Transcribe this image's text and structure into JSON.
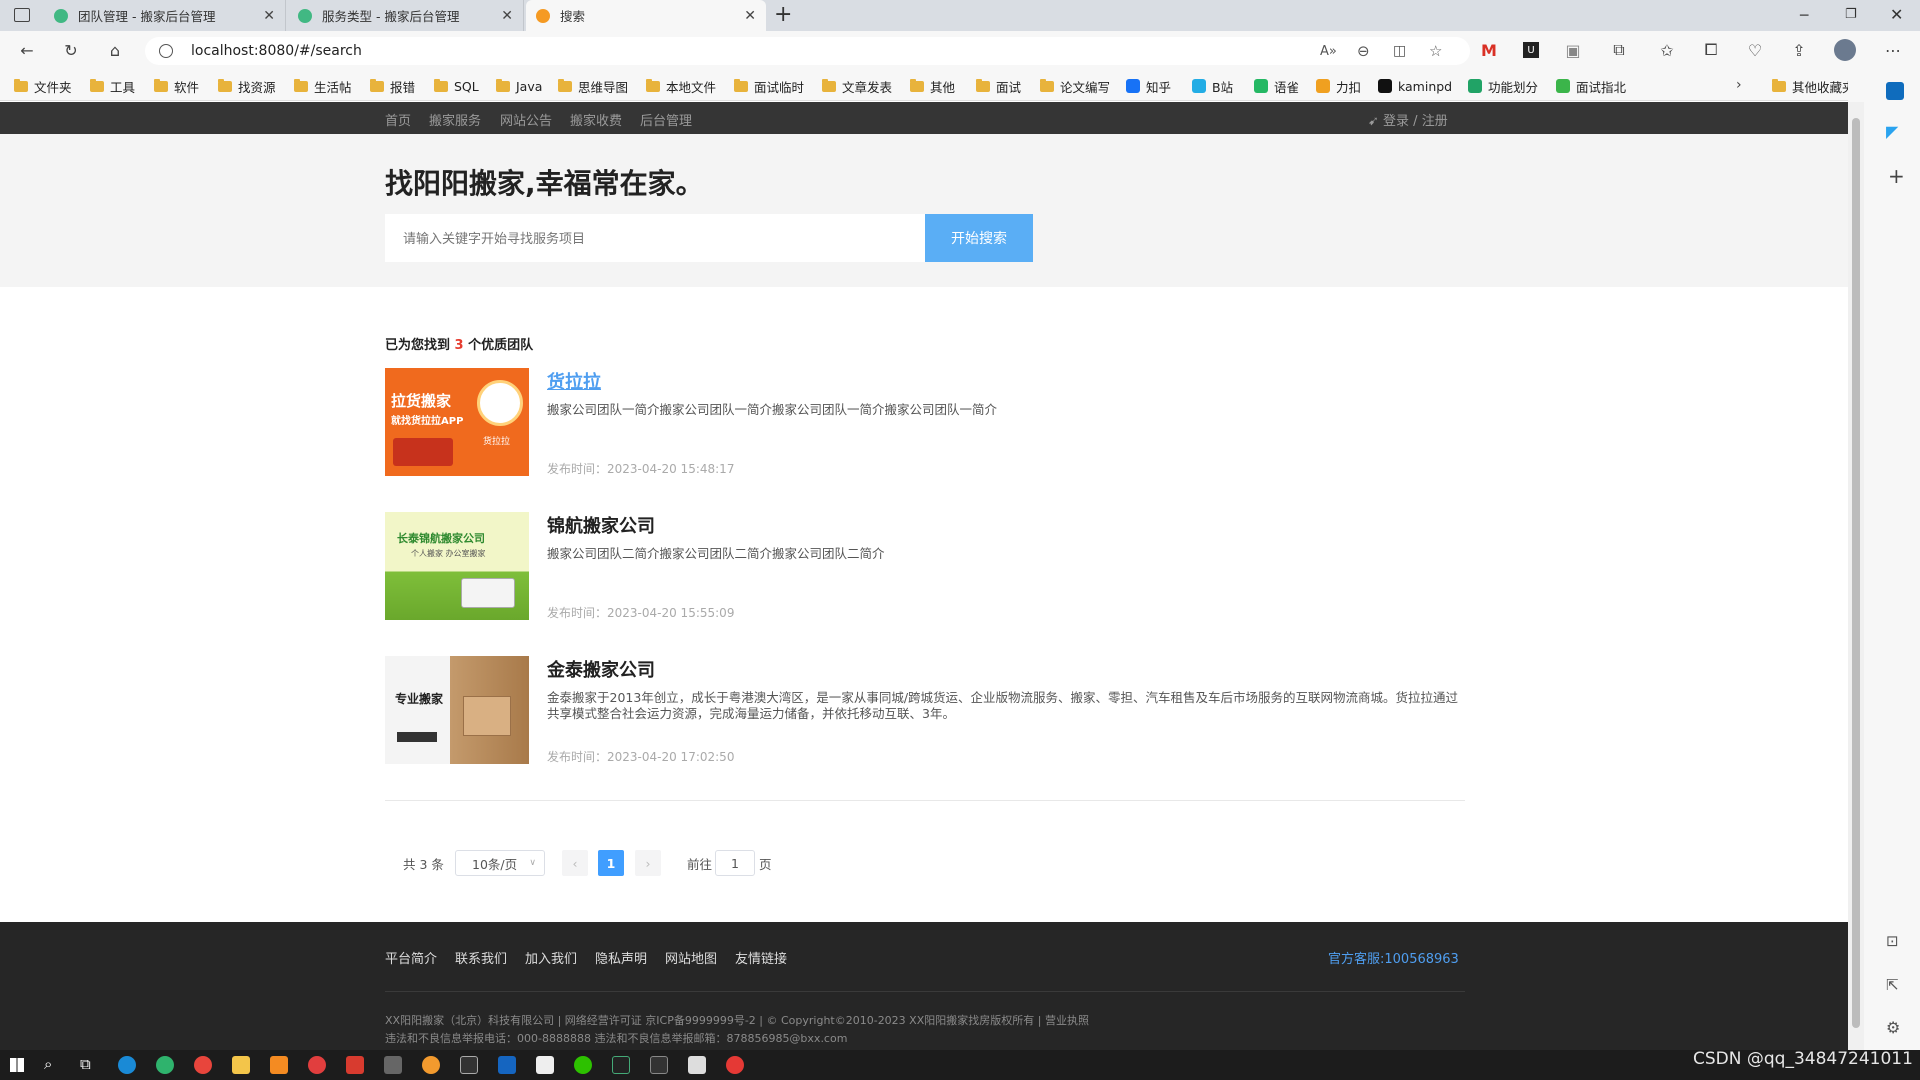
{
  "browser": {
    "tabs": [
      {
        "title": "团队管理 - 搬家后台管理",
        "favicon_color": "#41b883"
      },
      {
        "title": "服务类型 - 搬家后台管理",
        "favicon_color": "#41b883"
      },
      {
        "title": "搜索",
        "favicon_color": "#f59a23"
      }
    ],
    "new_tab": "+",
    "url": "localhost:8080/#/search",
    "window_controls": [
      "minimize-icon",
      "restore-icon",
      "close-icon"
    ],
    "bookmarks": [
      {
        "label": "文件夹",
        "type": "folder"
      },
      {
        "label": "工具",
        "type": "folder"
      },
      {
        "label": "软件",
        "type": "folder"
      },
      {
        "label": "找资源",
        "type": "folder"
      },
      {
        "label": "生活帖",
        "type": "folder"
      },
      {
        "label": "报错",
        "type": "folder"
      },
      {
        "label": "SQL",
        "type": "folder"
      },
      {
        "label": "Java",
        "type": "folder"
      },
      {
        "label": "思维导图",
        "type": "folder"
      },
      {
        "label": "本地文件",
        "type": "folder"
      },
      {
        "label": "面试临时",
        "type": "folder"
      },
      {
        "label": "文章发表",
        "type": "folder"
      },
      {
        "label": "其他",
        "type": "folder"
      },
      {
        "label": "面试",
        "type": "folder"
      },
      {
        "label": "论文编写",
        "type": "folder"
      },
      {
        "label": "知乎",
        "type": "site",
        "color": "#1772f6"
      },
      {
        "label": "B站",
        "type": "site",
        "color": "#23ade5"
      },
      {
        "label": "语雀",
        "type": "site",
        "color": "#25b864"
      },
      {
        "label": "力扣",
        "type": "site",
        "color": "#f0a020"
      },
      {
        "label": "kaminpd",
        "type": "site",
        "color": "#111111"
      },
      {
        "label": "功能划分",
        "type": "site",
        "color": "#21a366"
      },
      {
        "label": "面试指北",
        "type": "site",
        "color": "#3bb54a"
      }
    ],
    "other_bookmarks": "其他收藏夹"
  },
  "site": {
    "nav": [
      "首页",
      "搬家服务",
      "网站公告",
      "搬家收费",
      "后台管理"
    ],
    "login": "登录 / 注册",
    "slogan": "找阳阳搬家,幸福常在家。",
    "search_placeholder": "请输入关键字开始寻找服务项目",
    "search_button": "开始搜索",
    "found_prefix": "已为您找到",
    "found_count": "3",
    "found_suffix": "个优质团队",
    "results": [
      {
        "name": "货拉拉",
        "desc": "搬家公司团队一简介搬家公司团队一简介搬家公司团队一简介搬家公司团队一简介",
        "time": "发布时间：2023-04-20 15:48:17",
        "thumb_text": [
          "拉货搬家",
          "就找货拉拉APP",
          "货拉拉"
        ]
      },
      {
        "name": "锦航搬家公司",
        "desc": "搬家公司团队二简介搬家公司团队二简介搬家公司团队二简介",
        "time": "发布时间：2023-04-20 15:55:09",
        "thumb_text": [
          "长泰锦航搬家公司",
          "个人搬家 办公室搬家"
        ]
      },
      {
        "name": "金泰搬家公司",
        "desc": "金泰搬家于2013年创立，成长于粤港澳大湾区，是一家从事同城/跨城货运、企业版物流服务、搬家、零担、汽车租售及车后市场服务的互联网物流商城。货拉拉通过共享模式整合社会运力资源，完成海量运力储备，并依托移动互联、3年。",
        "time": "发布时间：2023-04-20 17:02:50",
        "thumb_text": [
          "专业搬家"
        ]
      }
    ],
    "pagination": {
      "total": "共 3 条",
      "page_size": "10条/页",
      "current": "1",
      "goto_prefix": "前往",
      "goto_value": "1",
      "goto_suffix": "页"
    },
    "footer": {
      "links": [
        "平台简介",
        "联系我们",
        "加入我们",
        "隐私声明",
        "网站地图",
        "友情链接"
      ],
      "hotline": "官方客服:100568963",
      "copyright": "XX阳阳搬家（北京）科技有限公司 | 网络经营许可证 京ICP备9999999号-2 | © Copyright©2010-2023 XX阳阳搬家找房版权所有 | 营业执照",
      "report": "违法和不良信息举报电话：000-8888888 违法和不良信息举报邮箱：878856985@bxx.com"
    }
  },
  "watermark": "CSDN @qq_34847241011"
}
